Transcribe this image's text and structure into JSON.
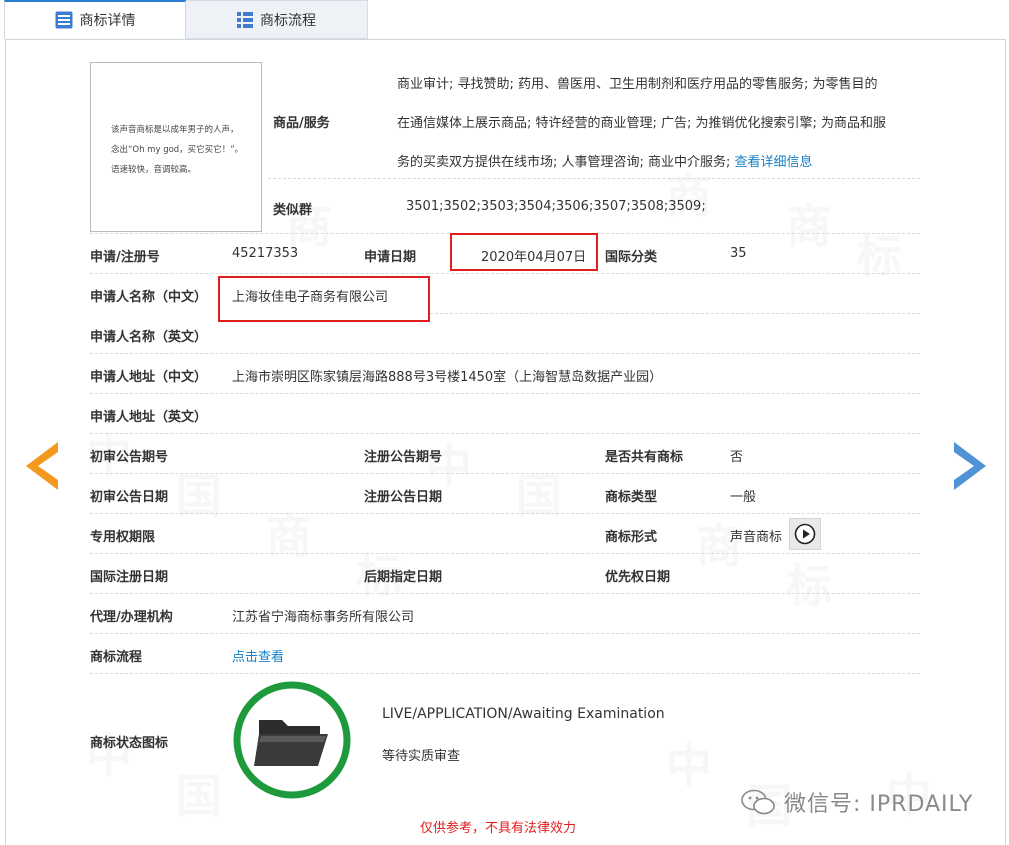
{
  "tabs": [
    {
      "label": "商标详情",
      "active": true,
      "icon": "list-detail-icon"
    },
    {
      "label": "商标流程",
      "active": false,
      "icon": "grid-list-icon"
    }
  ],
  "thumbnail": {
    "lines": [
      "该声音商标是以成年男子的人声，",
      "念出“Oh my god，买它买它！”。",
      "语速较快，音调较高。"
    ]
  },
  "goods": {
    "label": "商品/服务",
    "lines": [
      "商业审计; 寻找赞助; 药用、兽医用、卫生用制剂和医疗用品的零售服务; 为零售目的",
      "在通信媒体上展示商品; 特许经营的商业管理; 广告; 为推销优化搜索引擎; 为商品和服",
      "务的买卖双方提供在线市场; 人事管理咨询; 商业中介服务; "
    ],
    "more_link": "查看详细信息"
  },
  "similar_group": {
    "label": "类似群",
    "value": "3501;3502;3503;3504;3506;3507;3508;3509;"
  },
  "fields": {
    "reg_no_label": "申请/注册号",
    "reg_no": "45217353",
    "app_date_label": "申请日期",
    "app_date": "2020年04月07日",
    "intl_class_label": "国际分类",
    "intl_class": "35",
    "applicant_cn_label": "申请人名称（中文）",
    "applicant_cn": "上海妆佳电子商务有限公司",
    "applicant_en_label": "申请人名称（英文）",
    "applicant_en": "",
    "address_cn_label": "申请人地址（中文）",
    "address_cn": "上海市崇明区陈家镇层海路888号3号楼1450室（上海智慧岛数据产业园）",
    "address_en_label": "申请人地址（英文）",
    "address_en": "",
    "prelim_issue_label": "初审公告期号",
    "prelim_issue": "",
    "reg_issue_label": "注册公告期号",
    "reg_issue": "",
    "shared_label": "是否共有商标",
    "shared": "否",
    "prelim_date_label": "初审公告日期",
    "prelim_date": "",
    "reg_date_label": "注册公告日期",
    "reg_date": "",
    "mark_type_label": "商标类型",
    "mark_type": "一般",
    "exclusive_label": "专用权期限",
    "exclusive": "",
    "mark_form_label": "商标形式",
    "mark_form": "声音商标",
    "intl_reg_label": "国际注册日期",
    "intl_reg": "",
    "later_label": "后期指定日期",
    "later": "",
    "priority_label": "优先权日期",
    "priority": "",
    "agent_label": "代理/办理机构",
    "agent": "江苏省宁海商标事务所有限公司",
    "flow_label": "商标流程",
    "flow_link": "点击查看",
    "status_icon_label": "商标状态图标"
  },
  "status": {
    "en": "LIVE/APPLICATION/Awaiting Examination",
    "cn": "等待实质审查",
    "ring_color": "#1e9a3c"
  },
  "disclaimer": "仅供参考，不具有法律效力",
  "watermark": "微信号: IPRDAILY",
  "colors": {
    "highlight": "#e01e1e",
    "prev_arrow": "#f39a1e",
    "next_arrow": "#4f93d6",
    "link": "#1a82c8"
  }
}
